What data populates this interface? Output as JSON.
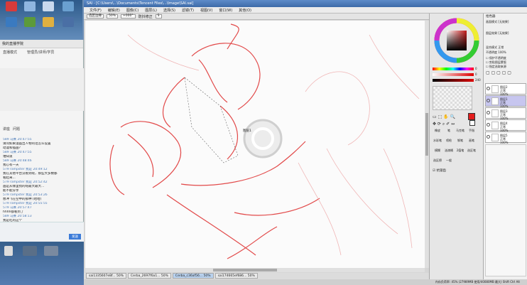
{
  "sai": {
    "title": "SAI - [C:\\Users\\...\\Documents\\Tencent Files\\...\\Image\\SAI.sai]",
    "menu": [
      "文件(F)",
      "编辑(E)",
      "图像(C)",
      "图层(L)",
      "选择(S)",
      "滤镜(T)",
      "视图(V)",
      "窗口(W)",
      "其他(O)"
    ],
    "toolbar": {
      "zoom": "50%",
      "angle": "+000°",
      "mode_label": "防抖修正",
      "mode_value": "S",
      "anti": "选区边缘"
    },
    "canvas_label": "图层1",
    "file_tabs": [
      "sai1335607e8f...",
      "Cerba_2697f6a1...",
      "Cerba_c36af56...",
      "sai174665ef686..."
    ],
    "file_tab_pct": [
      "50%",
      "50%",
      "50%",
      "50%"
    ],
    "status": "内存负荷率: 45%   (27989MB 使用/40080MB 最大)   Shift Ctrl Alt"
  },
  "color_panel": {
    "values": [
      "0",
      "0",
      "240"
    ],
    "tools": [
      "橡皮",
      "笔",
      "马克笔",
      "手指",
      "水彩笔",
      "喷枪",
      "钢笔",
      "画笔",
      "模糊",
      "油漆桶",
      "2值笔",
      "选区笔",
      "选区擦",
      "一般"
    ],
    "checkbox_label": "抗锯齿"
  },
  "layers": {
    "header": "拾色器",
    "rows": [
      {
        "mode": "画面模式",
        "value": "[无效果]"
      },
      {
        "mode": "图层效果",
        "value": "[无效果]"
      }
    ],
    "blend_label": "混合模式",
    "blend_value": "正常",
    "opacity_label": "不透明度",
    "opacity_value": "100%",
    "options": [
      "保护不透明度",
      "剪贴图层蒙版",
      "指定选取来源"
    ],
    "items": [
      {
        "name": "图层2",
        "mode": "正常",
        "opacity": "100%"
      },
      {
        "name": "图层1",
        "mode": "正常",
        "opacity": "100%"
      },
      {
        "name": "图层3",
        "mode": "正常",
        "opacity": "100%"
      },
      {
        "name": "图层4",
        "mode": "正常",
        "opacity": "100%"
      },
      {
        "name": "图层5",
        "mode": "正常",
        "opacity": "100%"
      }
    ]
  },
  "chat": {
    "title": "我的直播学院",
    "tab_1": "直播模式",
    "tab_2": "管理员/讲师/学员",
    "tab_3": "讲座",
    "tab_4": "问题",
    "messages": [
      {
        "meta": "589 马赛 20:47:55",
        "text": "请问如果漫画出人物的话怎么设置"
      },
      {
        "meta": "",
        "text": "动漫和插画?"
      },
      {
        "meta": "589 马赛 20:47:55",
        "text": "谁知道"
      },
      {
        "meta": "589 马赛 20:48:46",
        "text": "我心有一天"
      },
      {
        "meta": "579 rampster 我是 20:49:12",
        "text": "我在其他平台没看到呢，那些大多数都"
      },
      {
        "meta": "",
        "text": "看起来..."
      },
      {
        "meta": "579 rampster 我是 20:52:42",
        "text": "画是从哪里找的呢最大最大..."
      },
      {
        "meta": "",
        "text": "能不能分享"
      },
      {
        "meta": "579 rampster 我是 20:53:26",
        "text": "想冲飞在空中的那种 (哈哈)"
      },
      {
        "meta": "579 rampster 我是 20:55:55",
        "text": ""
      },
      {
        "meta": "579 马赛 20:57:47",
        "text": "hhhh都看到了"
      },
      {
        "meta": "589 马赛 20:58:13",
        "text": "我是吃的这个"
      }
    ],
    "send_label": "发送"
  },
  "desktop": {
    "icons": [
      "QQ",
      "回收站",
      "计算机",
      "文件"
    ]
  }
}
